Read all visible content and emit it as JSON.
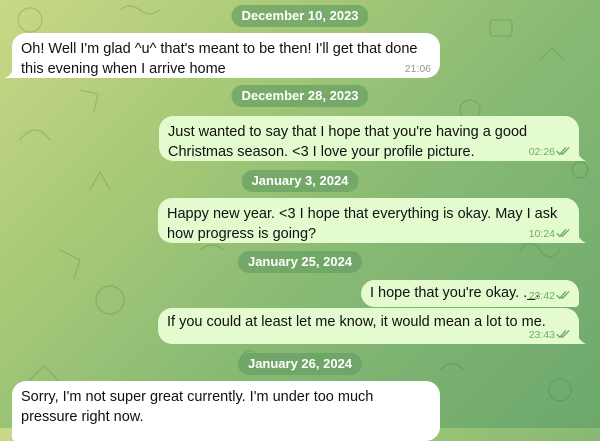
{
  "colors": {
    "background_top": "#c9d886",
    "background_bottom": "#6ca86c",
    "date_pill": "#68a064",
    "incoming_bubble": "#ffffff",
    "outgoing_bubble": "#e3fbcf",
    "outgoing_meta": "#6fae5f"
  },
  "icons": {
    "read_status": "double-check-icon"
  },
  "dates": [
    "December 10, 2023",
    "December 28, 2023",
    "January 3, 2024",
    "January 25, 2024",
    "January 26, 2024"
  ],
  "messages": [
    {
      "direction": "incoming",
      "text": "Oh! Well I'm glad ^u^ that's meant to be then! I'll get that done this evening when I arrive home",
      "time": "21:06"
    },
    {
      "direction": "outgoing",
      "text": "Just wanted to say that I hope that you're having a good Christmas season. <3 I love your profile picture.",
      "time": "02:26",
      "read": true
    },
    {
      "direction": "outgoing",
      "text": "Happy new year. <3 I hope that everything is okay. May I ask how progress is going?",
      "time": "10:24",
      "read": true
    },
    {
      "direction": "outgoing",
      "text": "I hope that you're okay. ._.",
      "time": "23:42",
      "read": true
    },
    {
      "direction": "outgoing",
      "text": "If you could at least let me know, it would mean a lot to me.",
      "time": "23:43",
      "read": true
    },
    {
      "direction": "incoming",
      "text": "Sorry, I'm not super great currently. I'm under too much pressure right now.",
      "time": ""
    }
  ]
}
